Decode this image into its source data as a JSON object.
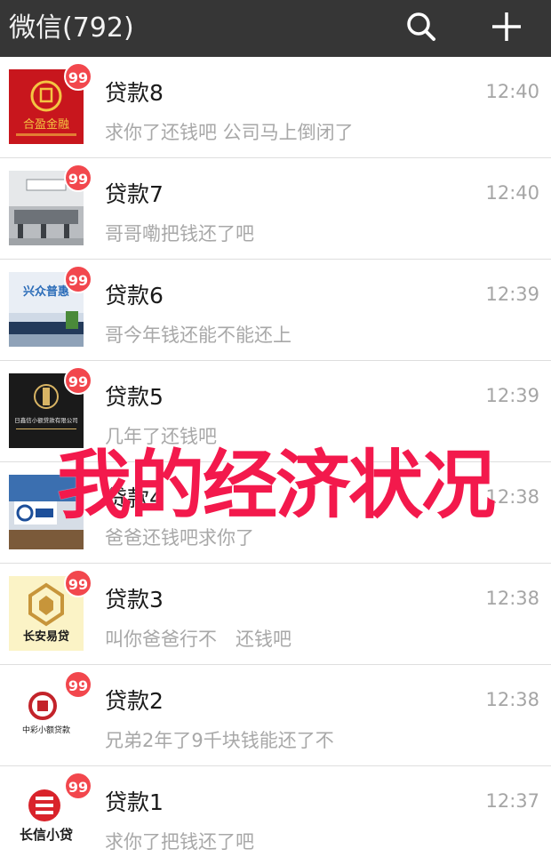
{
  "header": {
    "title": "微信(792)",
    "search_icon": "search-icon",
    "add_icon": "plus-icon",
    "bg_color": "#363636"
  },
  "chats": [
    {
      "name": "贷款8",
      "time": "12:40",
      "preview": "求你了还钱吧 公司马上倒闭了",
      "badge": "99",
      "avatar_label": "合盈金融"
    },
    {
      "name": "贷款7",
      "time": "12:40",
      "preview": "哥哥嘞把钱还了吧",
      "badge": "99"
    },
    {
      "name": "贷款6",
      "time": "12:39",
      "preview": "哥今年钱还能不能还上",
      "badge": "99",
      "avatar_label": "兴众普惠"
    },
    {
      "name": "贷款5",
      "time": "12:39",
      "preview": "几年了还钱吧",
      "badge": "99",
      "avatar_label": "日鑫信小额贷款有限公司"
    },
    {
      "name": "贷款4",
      "time": "12:38",
      "preview": "爸爸还钱吧求你了",
      "badge": ""
    },
    {
      "name": "贷款3",
      "time": "12:38",
      "preview": "叫你爸爸行不　还钱吧",
      "badge": "99",
      "avatar_label": "长安易贷"
    },
    {
      "name": "贷款2",
      "time": "12:38",
      "preview": "兄弟2年了9千块钱能还了不",
      "badge": "99",
      "avatar_label": "中彩小额贷款"
    },
    {
      "name": "贷款1",
      "time": "12:37",
      "preview": "求你了把钱还了吧",
      "badge": "99",
      "avatar_label": "长信小贷"
    }
  ],
  "overlay_caption": "我的经济状况",
  "colors": {
    "badge": "#f2474d",
    "caption": "#f3194c",
    "time": "#a5a5a5",
    "preview": "#a8a8a8"
  }
}
